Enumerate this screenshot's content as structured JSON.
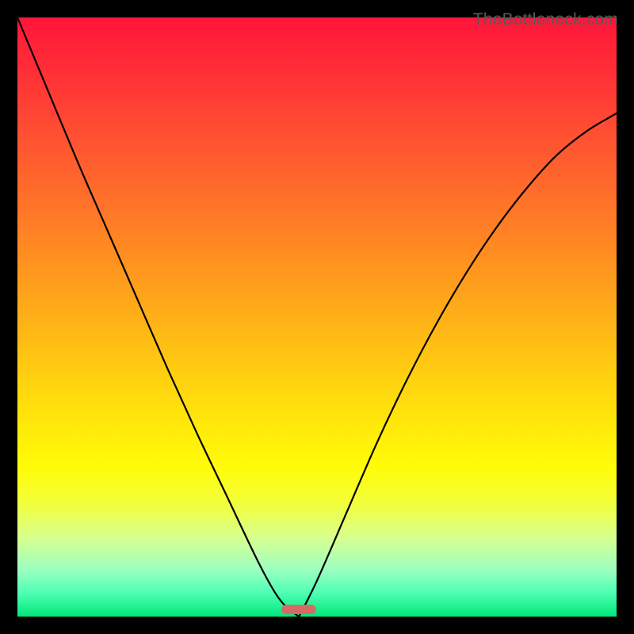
{
  "watermark": "TheBottleneck.com",
  "nub": {
    "left_frac": 0.47,
    "width_frac": 0.058,
    "color": "#d66b66"
  },
  "colors": {
    "frame": "#000000",
    "curve": "#000000",
    "gradient_top": "#ff153b",
    "gradient_bottom": "#00e87a"
  },
  "chart_data": {
    "type": "line",
    "title": "",
    "xlabel": "",
    "ylabel": "",
    "xlim": [
      0,
      1
    ],
    "ylim": [
      0,
      1
    ],
    "annotations": [
      "TheBottleneck.com"
    ],
    "nub_center_x": 0.47,
    "series": [
      {
        "name": "left-branch",
        "x": [
          0.0,
          0.05,
          0.1,
          0.15,
          0.2,
          0.25,
          0.3,
          0.35,
          0.4,
          0.43,
          0.45,
          0.47
        ],
        "y": [
          1.0,
          0.88,
          0.76,
          0.645,
          0.53,
          0.415,
          0.305,
          0.2,
          0.095,
          0.04,
          0.015,
          0.0
        ]
      },
      {
        "name": "right-branch",
        "x": [
          0.47,
          0.5,
          0.55,
          0.6,
          0.65,
          0.7,
          0.75,
          0.8,
          0.85,
          0.9,
          0.95,
          1.0
        ],
        "y": [
          0.0,
          0.06,
          0.175,
          0.29,
          0.395,
          0.49,
          0.575,
          0.65,
          0.715,
          0.77,
          0.81,
          0.84
        ]
      }
    ]
  }
}
